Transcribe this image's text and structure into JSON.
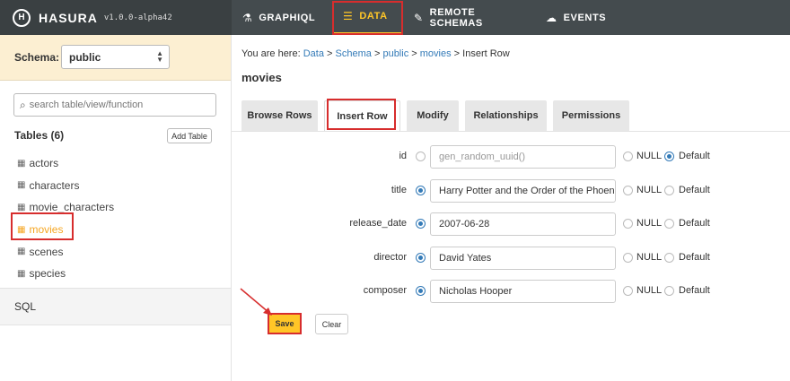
{
  "brand": {
    "logo_glyph": "H",
    "name": "HASURA",
    "version": "v1.0.0-alpha42"
  },
  "nav": [
    {
      "label": "GRAPHIQL",
      "icon": "flask-icon",
      "glyph": "⚗"
    },
    {
      "label": "DATA",
      "icon": "database-icon",
      "glyph": "☰"
    },
    {
      "label": "REMOTE SCHEMAS",
      "icon": "plug-icon",
      "glyph": "✎"
    },
    {
      "label": "EVENTS",
      "icon": "cloud-icon",
      "glyph": "☁"
    }
  ],
  "sidebar": {
    "schema_label": "Schema:",
    "schema_value": "public",
    "search_placeholder": "search table/view/function",
    "tables_title": "Tables (6)",
    "add_table_label": "Add Table",
    "tables": [
      "actors",
      "characters",
      "movie_characters",
      "movies",
      "scenes",
      "species"
    ],
    "active_table": "movies",
    "sql_label": "SQL"
  },
  "main": {
    "breadcrumb": {
      "prefix": "You are here:",
      "items": [
        "Data",
        "Schema",
        "public",
        "movies"
      ],
      "current": "Insert Row",
      "separator": ">"
    },
    "title": "movies",
    "tabs": [
      "Browse Rows",
      "Insert Row",
      "Modify",
      "Relationships",
      "Permissions"
    ],
    "active_tab": "Insert Row",
    "fields": [
      {
        "label": "id",
        "value": "gen_random_uuid()",
        "is_placeholder": true,
        "selected": "default"
      },
      {
        "label": "title",
        "value": "Harry Potter and the Order of the Phoenix",
        "is_placeholder": false,
        "selected": "value"
      },
      {
        "label": "release_date",
        "value": "2007-06-28",
        "is_placeholder": false,
        "selected": "value"
      },
      {
        "label": "director",
        "value": "David Yates",
        "is_placeholder": false,
        "selected": "value"
      },
      {
        "label": "composer",
        "value": "Nicholas Hooper",
        "is_placeholder": false,
        "selected": "value"
      }
    ],
    "null_label": "NULL",
    "default_label": "Default",
    "save_label": "Save",
    "clear_label": "Clear"
  },
  "colors": {
    "accent": "#ffc627",
    "highlight": "#d72d2d",
    "link": "#337ab7",
    "topbar": "#444b4e"
  }
}
